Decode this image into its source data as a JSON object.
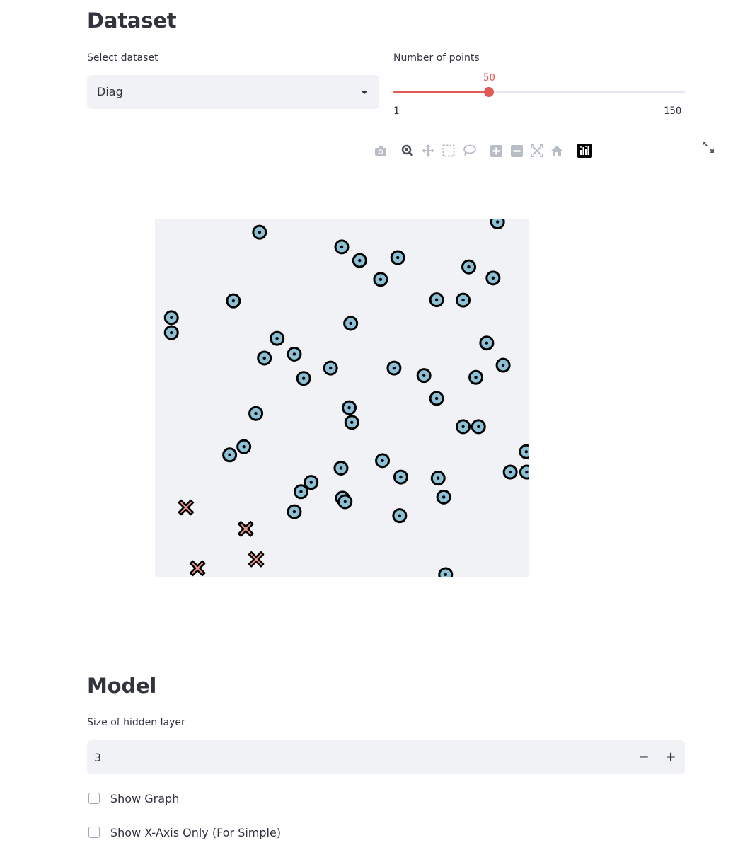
{
  "dataset": {
    "heading": "Dataset",
    "select_label": "Select dataset",
    "select_value": "Diag",
    "slider_label": "Number of points",
    "slider_value": 50,
    "slider_value_text": "50",
    "slider_min": "1",
    "slider_max": "150"
  },
  "modebar": {
    "icons": [
      "camera-icon",
      "zoom-icon",
      "pan-icon",
      "box-select-icon",
      "lasso-select-icon",
      "zoom-in-icon",
      "zoom-out-icon",
      "autoscale-icon",
      "reset-axes-icon",
      "plotly-logo-icon"
    ]
  },
  "chart_data": {
    "type": "scatter",
    "title": "",
    "xlabel": "",
    "ylabel": "",
    "xlim": [
      0,
      1
    ],
    "ylim": [
      0,
      1
    ],
    "grid": false,
    "background": "#f0f2f6",
    "series": [
      {
        "marker": "circle-dot",
        "color": "#8cc0d4",
        "points": [
          [
            0.28,
            0.964
          ],
          [
            0.5,
            0.923
          ],
          [
            0.548,
            0.885
          ],
          [
            0.65,
            0.893
          ],
          [
            0.84,
            0.867
          ],
          [
            0.917,
            0.993
          ],
          [
            0.905,
            0.836
          ],
          [
            0.604,
            0.832
          ],
          [
            0.754,
            0.775
          ],
          [
            0.21,
            0.772
          ],
          [
            0.825,
            0.774
          ],
          [
            0.044,
            0.725
          ],
          [
            0.044,
            0.683
          ],
          [
            0.524,
            0.709
          ],
          [
            0.327,
            0.667
          ],
          [
            0.293,
            0.612
          ],
          [
            0.373,
            0.623
          ],
          [
            0.47,
            0.584
          ],
          [
            0.398,
            0.555
          ],
          [
            0.888,
            0.654
          ],
          [
            0.932,
            0.592
          ],
          [
            0.64,
            0.584
          ],
          [
            0.72,
            0.563
          ],
          [
            0.859,
            0.558
          ],
          [
            0.754,
            0.499
          ],
          [
            0.27,
            0.457
          ],
          [
            0.52,
            0.473
          ],
          [
            0.527,
            0.432
          ],
          [
            0.825,
            0.42
          ],
          [
            0.866,
            0.42
          ],
          [
            0.238,
            0.364
          ],
          [
            0.2,
            0.341
          ],
          [
            0.609,
            0.325
          ],
          [
            0.994,
            0.35
          ],
          [
            0.498,
            0.304
          ],
          [
            0.658,
            0.279
          ],
          [
            0.758,
            0.276
          ],
          [
            0.951,
            0.293
          ],
          [
            0.995,
            0.293
          ],
          [
            0.418,
            0.264
          ],
          [
            0.391,
            0.238
          ],
          [
            0.502,
            0.22
          ],
          [
            0.509,
            0.21
          ],
          [
            0.373,
            0.182
          ],
          [
            0.655,
            0.171
          ],
          [
            0.773,
            0.223
          ],
          [
            0.778,
            0.006
          ]
        ]
      },
      {
        "marker": "x",
        "color": "#e8958b",
        "points": [
          [
            0.083,
            0.194
          ],
          [
            0.243,
            0.134
          ],
          [
            0.271,
            0.049
          ],
          [
            0.114,
            0.024
          ]
        ]
      }
    ]
  },
  "model": {
    "heading": "Model",
    "hidden_label": "Size of hidden layer",
    "hidden_value": "3",
    "minus": "−",
    "plus": "+",
    "show_graph": "Show Graph",
    "show_x_axis": "Show X-Axis Only (For Simple)"
  }
}
